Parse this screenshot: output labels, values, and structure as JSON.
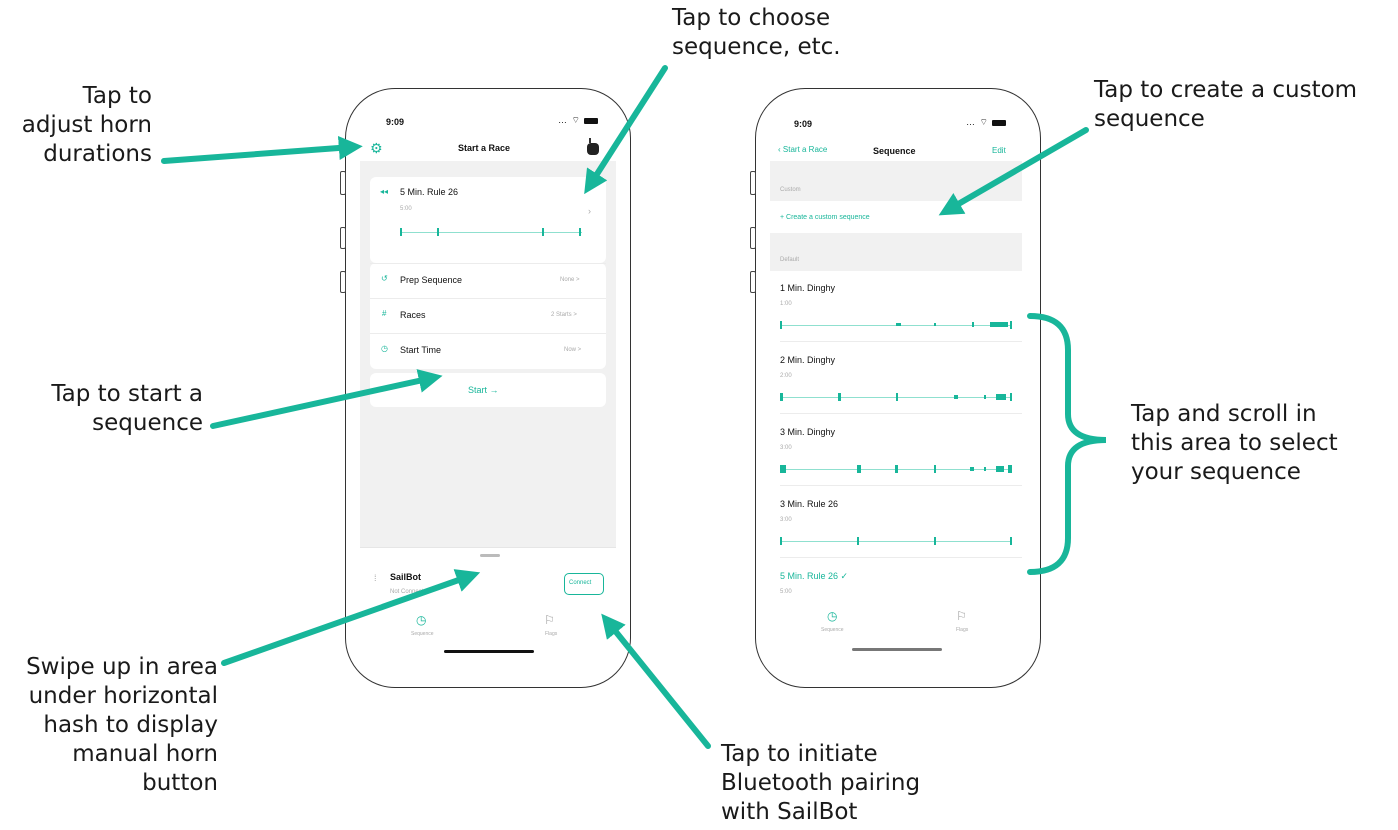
{
  "callouts": {
    "horn": "Tap to\nadjust horn\ndurations",
    "choose": "Tap to choose\nsequence, etc.",
    "start": "Tap to start a\nsequence",
    "swipe": "Swipe up in area\nunder horizontal\nhash to display\nmanual horn\nbutton",
    "bluetooth": "Tap to initiate\nBluetooth pairing\nwith SailBot",
    "custom": "Tap to create a custom\nsequence",
    "scroll": "Tap and scroll in\nthis area to select\nyour sequence"
  },
  "colors": {
    "accent": "#18b69a",
    "annotation": "#18b69a"
  },
  "left_screen": {
    "time": "9:09",
    "title": "Start a Race",
    "sequence": {
      "name": "5 Min. Rule 26",
      "duration": "5:00"
    },
    "rows": [
      {
        "label": "Prep Sequence",
        "value": "None >"
      },
      {
        "label": "Races",
        "value": "2 Starts >"
      },
      {
        "label": "Start Time",
        "value": "Now >"
      }
    ],
    "start_button": "Start →",
    "device": {
      "name": "SailBot",
      "status": "Not Connected",
      "connect": "Connect"
    },
    "tabs": [
      "Sequence",
      "Flags"
    ]
  },
  "right_screen": {
    "time": "9:09",
    "back": "Start a Race",
    "title": "Sequence",
    "edit": "Edit",
    "custom_header": "Custom",
    "create_custom": "+   Create a custom sequence",
    "default_header": "Default",
    "sequences": [
      {
        "name": "1 Min. Dinghy",
        "duration": "1:00"
      },
      {
        "name": "2 Min. Dinghy",
        "duration": "2:00"
      },
      {
        "name": "3 Min. Dinghy",
        "duration": "3:00"
      },
      {
        "name": "3 Min. Rule 26",
        "duration": "3:00"
      },
      {
        "name": "5 Min. Rule 26 ✓",
        "duration": "5:00"
      }
    ],
    "tabs": [
      "Sequence",
      "Flags"
    ]
  }
}
